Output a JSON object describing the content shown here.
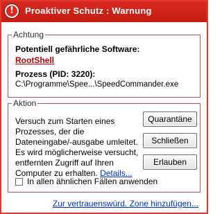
{
  "window": {
    "title": "Proaktiver Schutz : Warnung",
    "title_icon": "warning-exclamation-icon",
    "accent_color": "#d0241a"
  },
  "achtung": {
    "legend": "Achtung",
    "software_label": "Potentiell gefährliche Software:",
    "software_name": "RootShell",
    "process_label": "Prozess (PID: 3220):",
    "process_path": "C:\\Programme\\Spee...\\SpeedCommander.exe"
  },
  "aktion": {
    "legend": "Aktion",
    "description": "Versuch zum Starten eines Prozesses, der die Dateneingabe/-ausgabe umleitet. Es wird möglicherweise versucht, entfernten Zugriff auf Ihren Computer zu erhalten.",
    "details_link": "Details...",
    "buttons": {
      "quarantine": "Quarantäne",
      "close": "Schließen",
      "allow": "Erlauben"
    },
    "checkbox_label": "In allen ähnlichen Fällen anwenden",
    "checkbox_checked": false
  },
  "footer": {
    "trusted_zone_link": "Zur vertrauenswürd. Zone hinzufügen..."
  }
}
